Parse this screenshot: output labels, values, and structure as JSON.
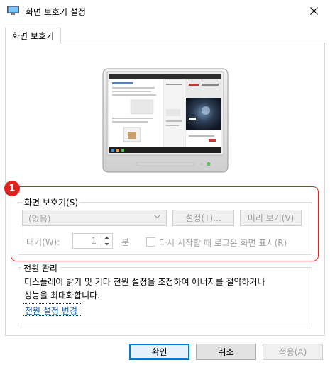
{
  "window": {
    "title": "화면 보호기 설정",
    "close_symbol": "✕"
  },
  "tab": {
    "label": "화면 보호기"
  },
  "callout": {
    "number": "1"
  },
  "screensaver": {
    "group_label": "화면 보호기(S)",
    "selected_value": "(없음)",
    "settings_button": "설정(T)...",
    "preview_button": "미리 보기(V)",
    "wait_label": "대기(W):",
    "wait_value": "1",
    "wait_unit": "분",
    "resume_checkbox_label": "다시 시작할 때 로그온 화면 표시(R)",
    "resume_checked": false
  },
  "power": {
    "group_label": "전원 관리",
    "description_line1": "디스플레이 밝기 및 기타 전원 설정을 조정하여 에너지를 절약하거나",
    "description_line2": "성능을 최대화합니다.",
    "link": "전원 설정 변경"
  },
  "footer": {
    "ok": "확인",
    "cancel": "취소",
    "apply": "적용(A)"
  },
  "colors": {
    "highlight": "#e0221e",
    "link": "#1a5fb4",
    "focus": "#0078d7"
  }
}
